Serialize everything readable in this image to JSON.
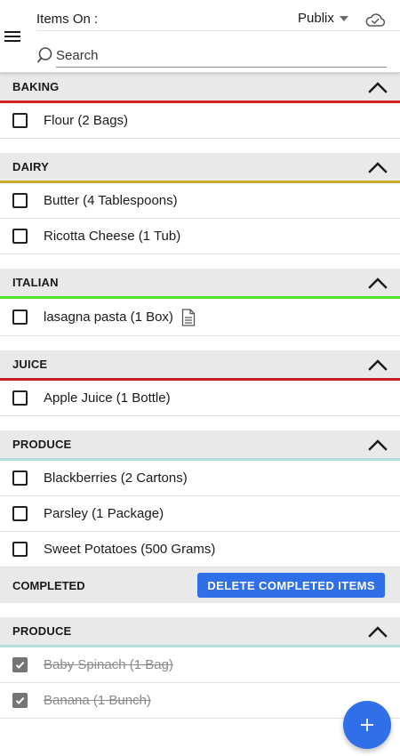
{
  "header": {
    "items_on_label": "Items On :",
    "store": "Publix",
    "search_placeholder": "Search",
    "menu_icon": "hamburger-menu-icon",
    "sync_icon": "cloud-check-icon"
  },
  "sections": [
    {
      "name": "BAKING",
      "accent": "#d32020",
      "items": [
        {
          "label": "Flour (2 Bags)"
        }
      ]
    },
    {
      "name": "DAIRY",
      "accent": "#c9ab2c",
      "items": [
        {
          "label": "Butter (4 Tablespoons)"
        },
        {
          "label": "Ricotta Cheese (1 Tub)"
        }
      ]
    },
    {
      "name": "ITALIAN",
      "accent": "#55e02a",
      "items": [
        {
          "label": "lasagna pasta (1 Box)",
          "has_note": true
        }
      ]
    },
    {
      "name": "JUICE",
      "accent": "#c42222",
      "items": [
        {
          "label": "Apple Juice (1 Bottle)"
        }
      ]
    },
    {
      "name": "PRODUCE",
      "accent": "#b7dcdc",
      "items": [
        {
          "label": "Blackberries (2 Cartons)"
        },
        {
          "label": "Parsley (1 Package)"
        },
        {
          "label": "Sweet Potatoes (500 Grams)"
        }
      ]
    }
  ],
  "completed": {
    "title": "COMPLETED",
    "delete_label": "DELETE COMPLETED ITEMS",
    "sections": [
      {
        "name": "PRODUCE",
        "accent": "#b7dcdc",
        "items": [
          {
            "label": "Baby Spinach (1 Bag)",
            "checked": true
          },
          {
            "label": "Banana (1 Bunch)",
            "checked": true
          }
        ]
      }
    ]
  },
  "fab": {
    "icon": "plus-icon"
  },
  "colors": {
    "primary": "#2f6fe8",
    "section_bg": "#e9e9e9"
  }
}
